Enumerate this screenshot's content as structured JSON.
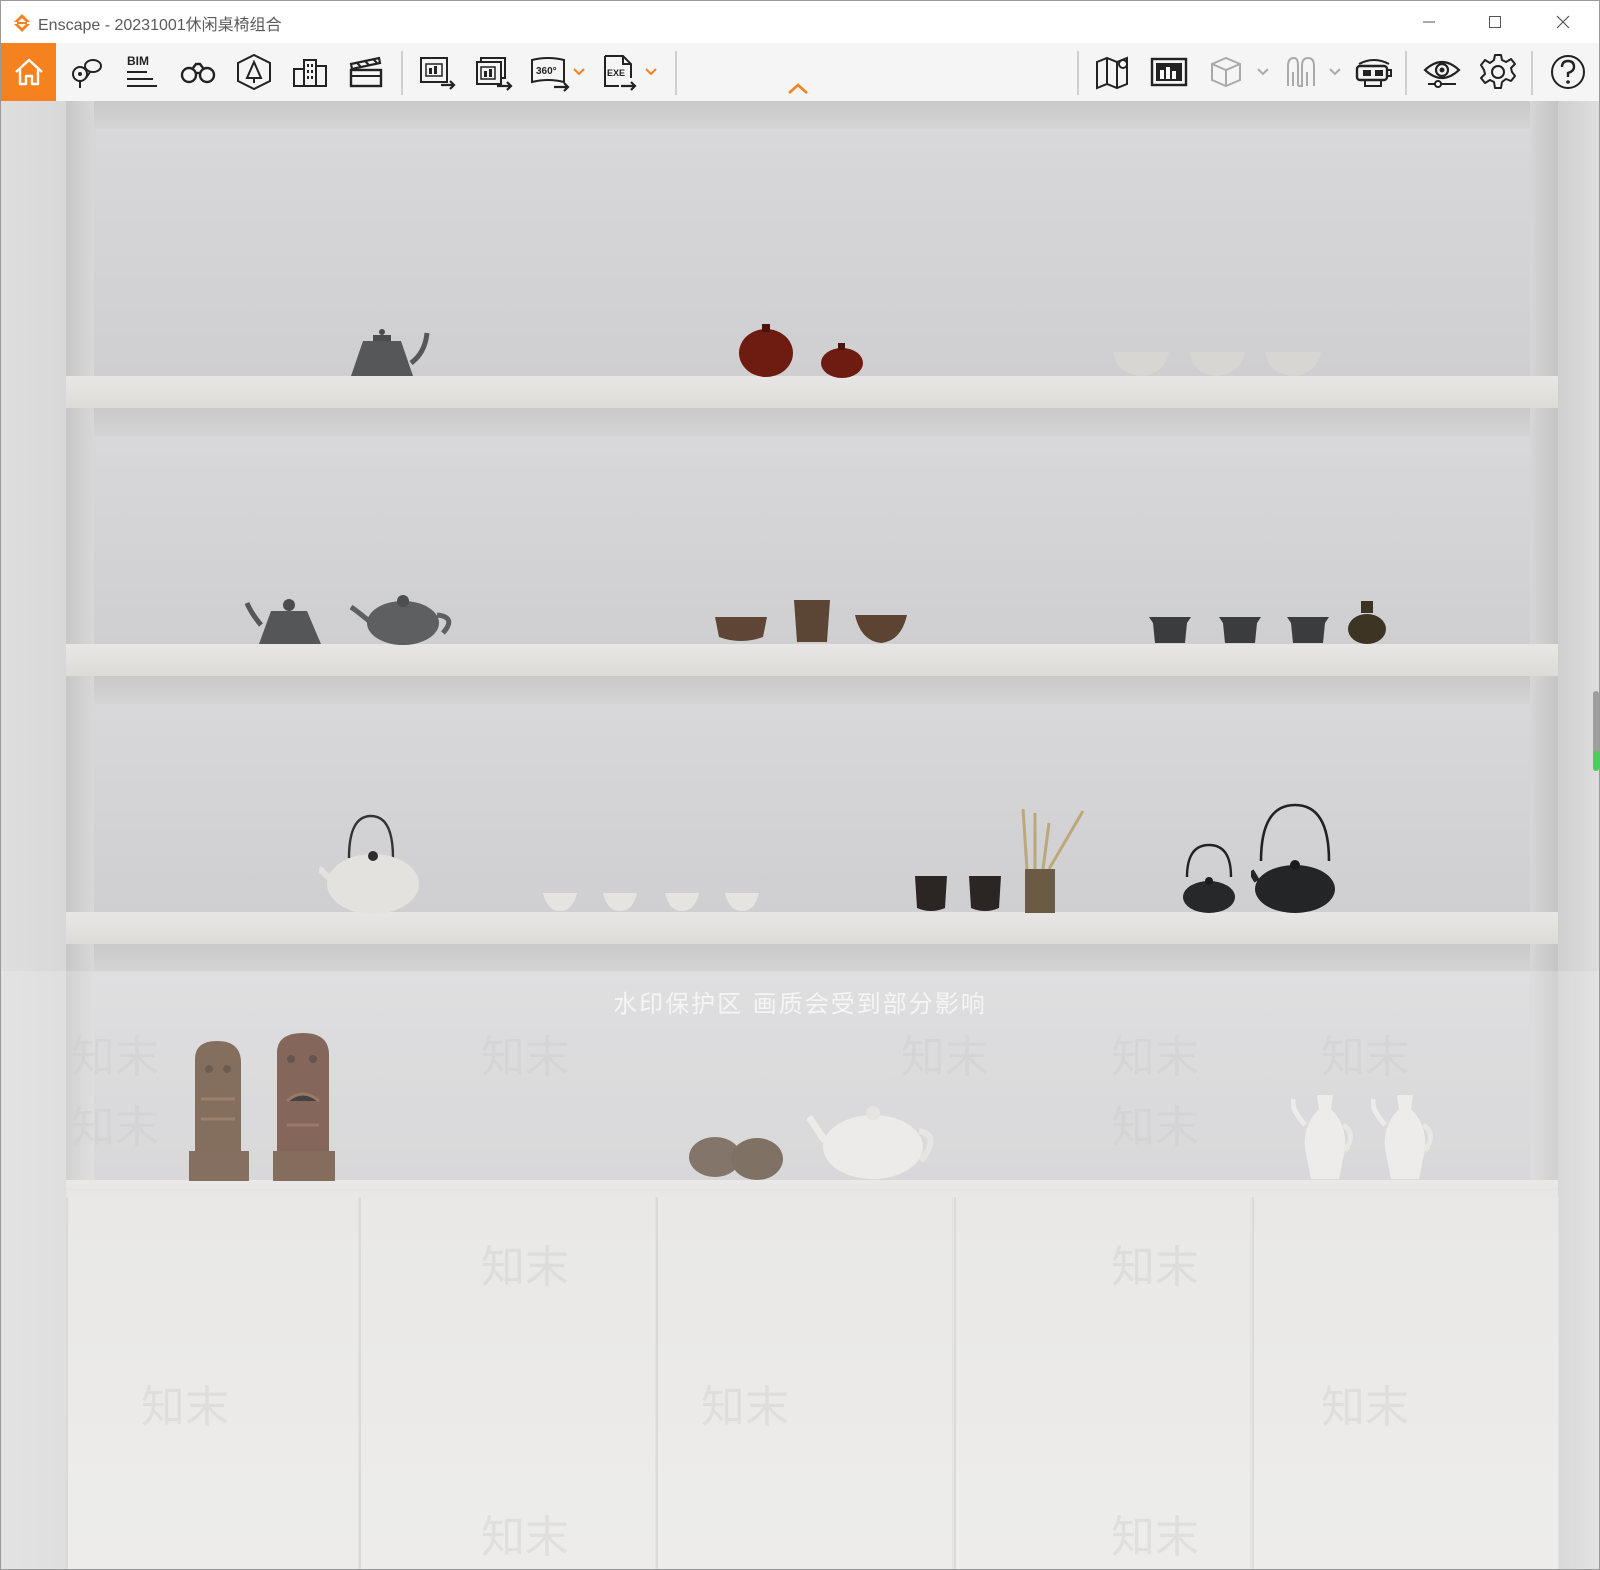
{
  "window": {
    "app_name": "Enscape",
    "separator": " - ",
    "project_name": "20231001休闲桌椅组合",
    "accent_color": "#f6821f"
  },
  "window_controls": [
    "minimize-icon",
    "maximize-icon",
    "close-icon"
  ],
  "toolbar": {
    "bim_label": "BIM",
    "pano_label": "360°",
    "exe_label": "EXE",
    "left_tools": [
      "home-icon",
      "asset-library-icon",
      "bim-icon",
      "views-binoculars-icon",
      "site-context-icon",
      "buildings-icon",
      "video-editor-icon",
      "export-image-icon",
      "batch-export-icon",
      "panorama-360-icon",
      "export-exe-icon"
    ],
    "right_tools": [
      "map-icon",
      "image-gallery-icon",
      "cube-icon",
      "walk-people-icon",
      "vr-headset-icon",
      "visual-settings-eye-icon",
      "settings-gear-icon",
      "help-icon"
    ]
  },
  "watermark": {
    "notice": "水印保护区   画质会受到部分影响",
    "brand": "知末"
  }
}
